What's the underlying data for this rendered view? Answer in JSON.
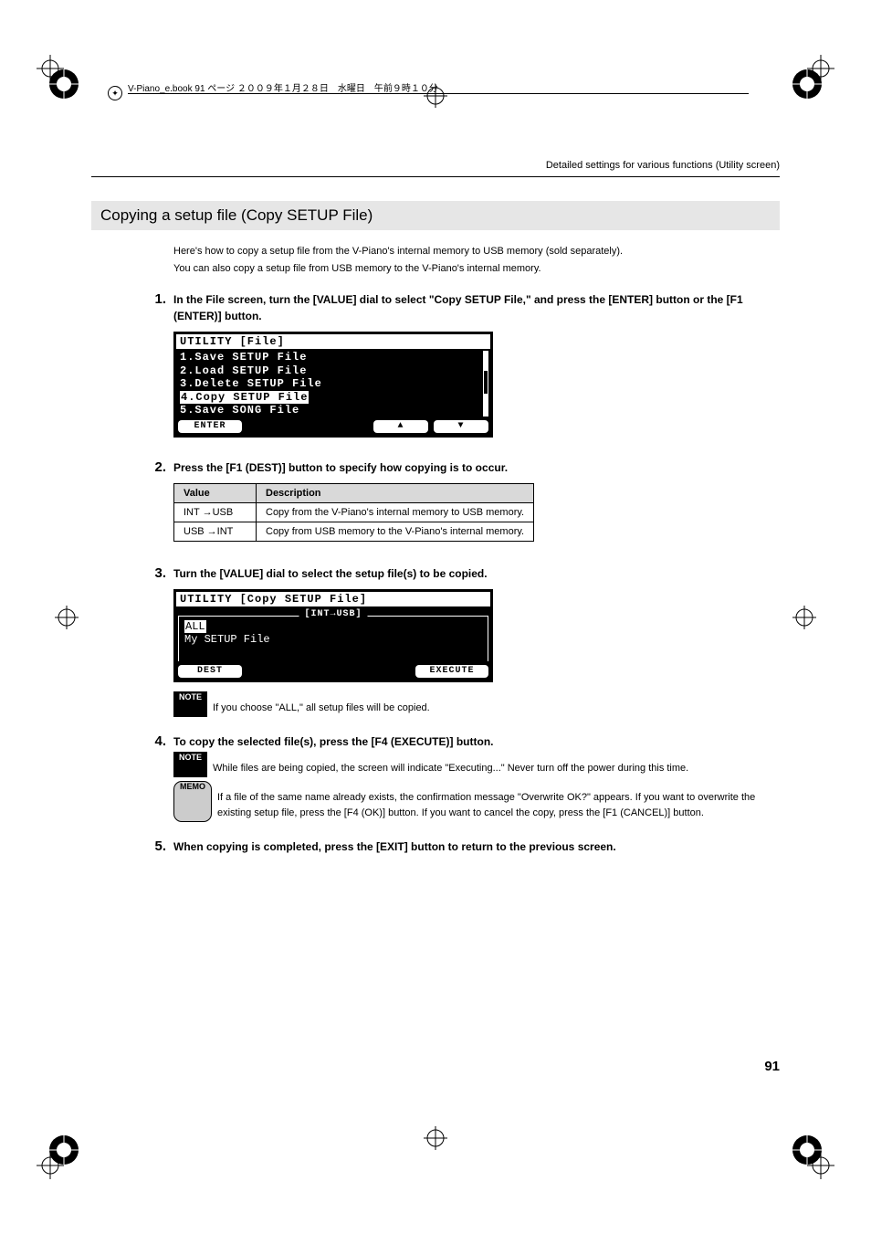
{
  "binding_text": "V-Piano_e.book  91 ページ  ２００９年１月２８日　水曜日　午前９時１０分",
  "running_header": "Detailed settings for various functions (Utility screen)",
  "section_title": "Copying a setup file (Copy SETUP File)",
  "intro_line1": "Here's how to copy a setup file from the V-Piano's internal memory to USB memory (sold separately).",
  "intro_line2": "You can also copy a setup file from USB memory to the V-Piano's internal memory.",
  "steps": {
    "s1": {
      "num": "1.",
      "text": "In the File screen, turn the [VALUE] dial to select \"Copy SETUP File,\" and press the [ENTER] button or the [F1 (ENTER)] button."
    },
    "s2": {
      "num": "2.",
      "text": "Press the [F1 (DEST)] button to specify how copying is to occur."
    },
    "s3": {
      "num": "3.",
      "text": "Turn the [VALUE] dial to select the setup file(s) to be copied."
    },
    "s4": {
      "num": "4.",
      "text": "To copy the selected file(s), press the [F4 (EXECUTE)] button."
    },
    "s5": {
      "num": "5.",
      "text": "When copying is completed, press the [EXIT] button to return to the previous screen."
    }
  },
  "lcd1": {
    "title": "UTILITY [File]",
    "lines": [
      "1.Save SETUP File",
      "2.Load SETUP File",
      "3.Delete SETUP File",
      "4.Copy SETUP File",
      "5.Save SONG File"
    ],
    "highlighted_index": 3,
    "footer_left": "ENTER",
    "footer_up": "▲",
    "footer_down": "▼"
  },
  "lcd2": {
    "title": "UTILITY [Copy SETUP File]",
    "subtitle": "[INT→USB]",
    "line_hl": "ALL",
    "line2": "My SETUP File",
    "footer_left": "DEST",
    "footer_right": "EXECUTE"
  },
  "table": {
    "headers": [
      "Value",
      "Description"
    ],
    "rows": [
      [
        "INT →USB",
        "Copy from the V-Piano's internal memory to USB memory."
      ],
      [
        "USB →INT",
        "Copy from USB memory to the V-Piano's internal memory."
      ]
    ]
  },
  "badges": {
    "note": "NOTE",
    "memo": "MEMO"
  },
  "note3": "If you choose \"ALL,\" all setup files will be copied.",
  "note4a": "While files are being copied, the screen will indicate \"Executing...\" Never turn off the power during this time.",
  "note4b": "If a file of the same name already exists, the confirmation message \"Overwrite OK?\" appears. If you want to overwrite the existing setup file, press the [F4 (OK)] button. If you want to cancel the copy, press the [F1 (CANCEL)] button.",
  "page_number": "91"
}
